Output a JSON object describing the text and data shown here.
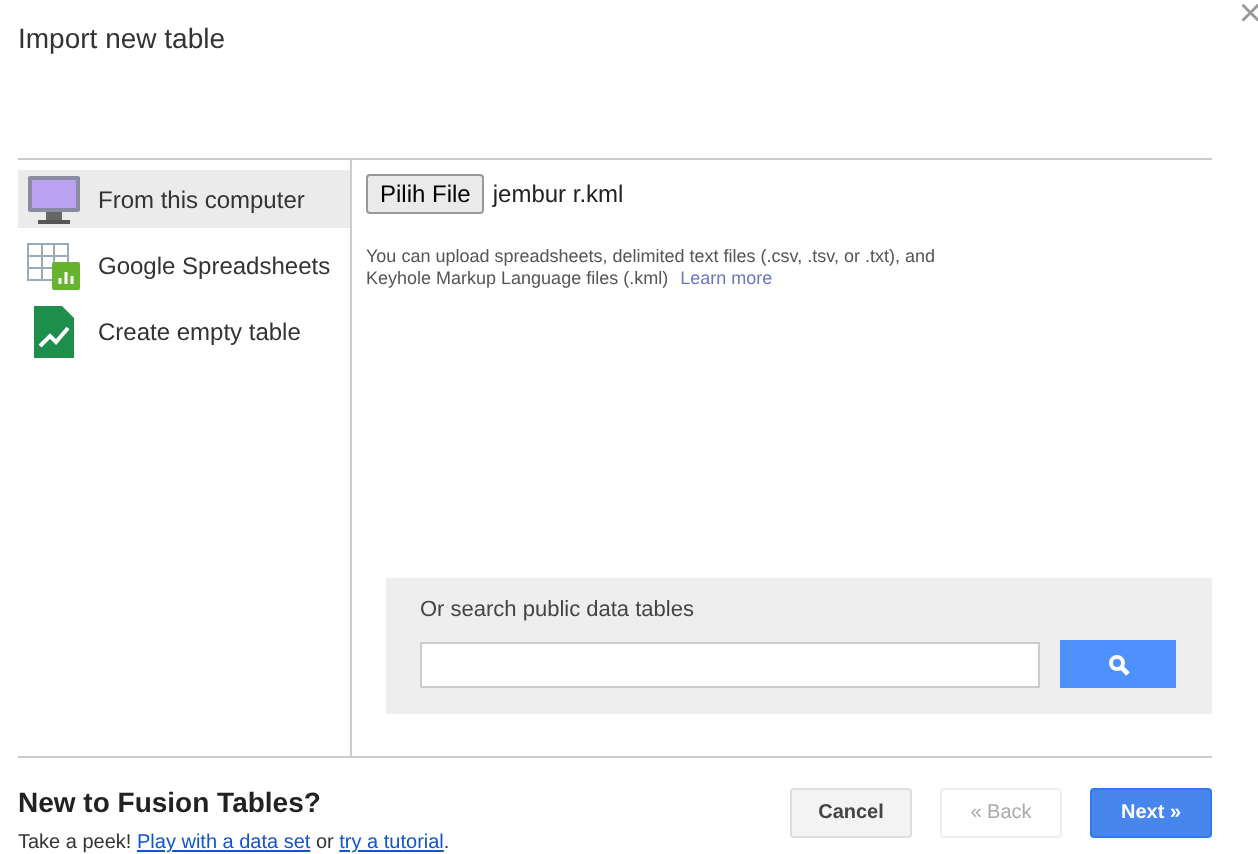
{
  "dialog": {
    "title": "Import new table",
    "close": "×"
  },
  "sidebar": {
    "items": [
      {
        "kind": "computer",
        "label": "From this computer",
        "selected": true
      },
      {
        "kind": "spreadsheet",
        "label": "Google Spreadsheets",
        "selected": false
      },
      {
        "kind": "empty",
        "label": "Create empty table",
        "selected": false
      }
    ]
  },
  "upload": {
    "button": "Pilih File",
    "file_name": "jembur r.kml",
    "help": "You can upload spreadsheets, delimited text files (.csv, .tsv, or .txt), and Keyhole Markup Language files (.kml)",
    "help_link": "Learn more"
  },
  "search": {
    "label": "Or search public data tables"
  },
  "footer": {
    "heading": "New to Fusion Tables?",
    "intro": [
      {
        "kind": "text",
        "text": "Take a peek! "
      },
      {
        "kind": "link",
        "text": "Play with a data set"
      },
      {
        "kind": "text",
        "text": " or "
      },
      {
        "kind": "link",
        "text": "try a tutorial"
      },
      {
        "kind": "text",
        "text": "."
      }
    ]
  },
  "buttons": [
    {
      "kind": "plain",
      "label": "Cancel",
      "disabled": false
    },
    {
      "kind": "plain",
      "label": "« Back",
      "disabled": true
    },
    {
      "kind": "primary",
      "label": "Next »",
      "disabled": false
    }
  ]
}
